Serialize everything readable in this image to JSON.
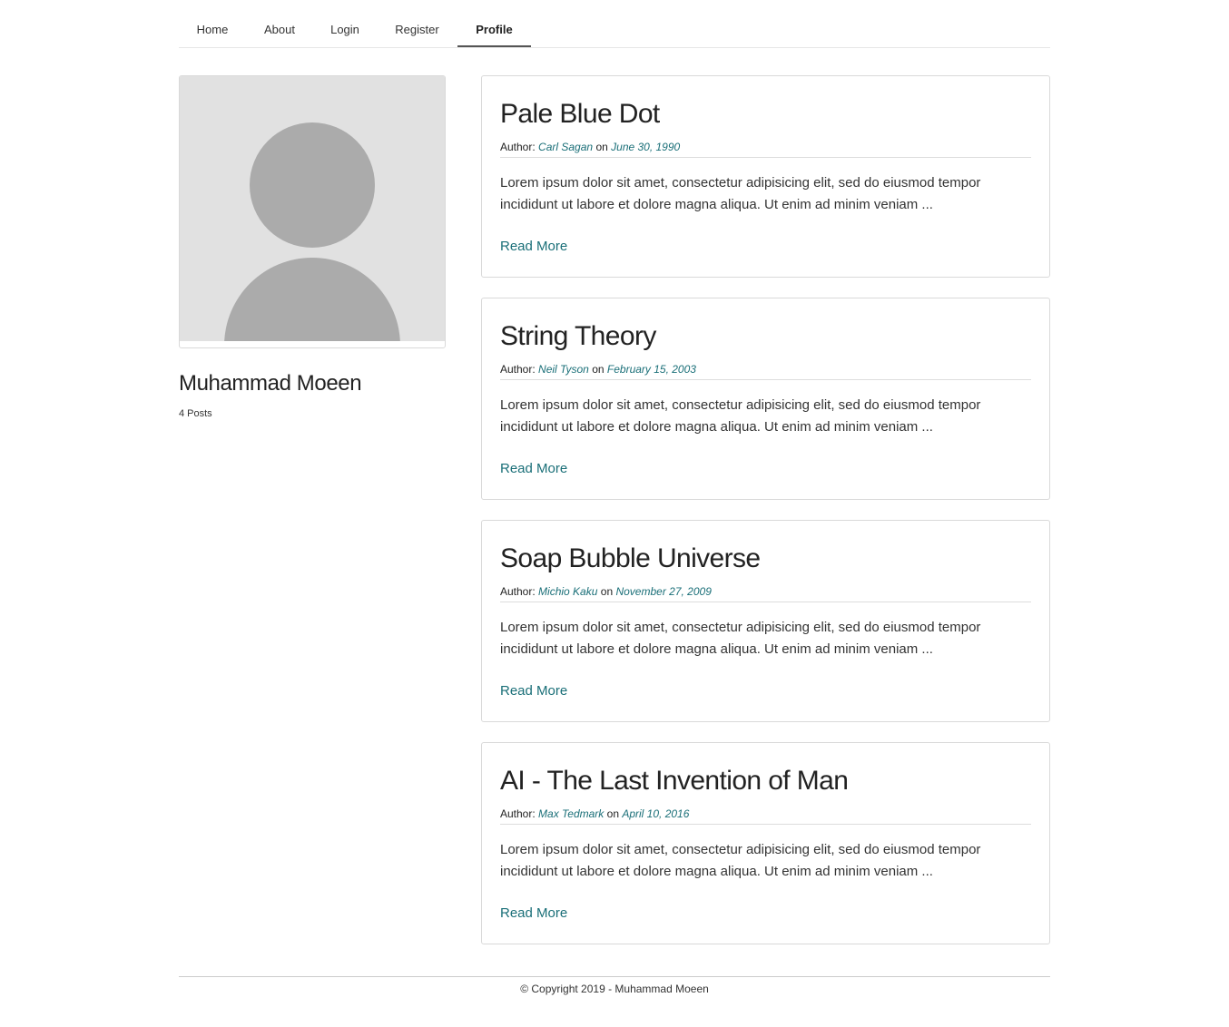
{
  "nav": {
    "items": [
      {
        "label": "Home"
      },
      {
        "label": "About"
      },
      {
        "label": "Login"
      },
      {
        "label": "Register"
      },
      {
        "label": "Profile",
        "active": true
      }
    ]
  },
  "profile": {
    "name": "Muhammad Moeen",
    "post_count": "4 Posts",
    "avatar_icon": "user-placeholder-icon"
  },
  "posts": [
    {
      "title": "Pale Blue Dot",
      "author_prefix": "Author:",
      "author": "Carl Sagan",
      "on": "on",
      "date": "June 30, 1990",
      "excerpt": "Lorem ipsum dolor sit amet, consectetur adipisicing elit, sed do eiusmod tempor incididunt ut labore et dolore magna aliqua. Ut enim ad minim veniam ...",
      "read_more": "Read More"
    },
    {
      "title": "String Theory",
      "author_prefix": "Author:",
      "author": "Neil Tyson",
      "on": "on",
      "date": "February 15, 2003",
      "excerpt": "Lorem ipsum dolor sit amet, consectetur adipisicing elit, sed do eiusmod tempor incididunt ut labore et dolore magna aliqua. Ut enim ad minim veniam ...",
      "read_more": "Read More"
    },
    {
      "title": "Soap Bubble Universe",
      "author_prefix": "Author:",
      "author": "Michio Kaku",
      "on": "on",
      "date": "November 27, 2009",
      "excerpt": "Lorem ipsum dolor sit amet, consectetur adipisicing elit, sed do eiusmod tempor incididunt ut labore et dolore magna aliqua. Ut enim ad minim veniam ...",
      "read_more": "Read More"
    },
    {
      "title": "AI - The Last Invention of Man",
      "author_prefix": "Author:",
      "author": "Max Tedmark",
      "on": "on",
      "date": "April 10, 2016",
      "excerpt": "Lorem ipsum dolor sit amet, consectetur adipisicing elit, sed do eiusmod tempor incididunt ut labore et dolore magna aliqua. Ut enim ad minim veniam ...",
      "read_more": "Read More"
    }
  ],
  "footer": {
    "text": "© Copyright 2019 - Muhammad Moeen"
  },
  "colors": {
    "link": "#1a6f78",
    "avatar_bg": "#e1e1e1",
    "avatar_fg": "#ababab",
    "border": "#d9d9d9"
  }
}
